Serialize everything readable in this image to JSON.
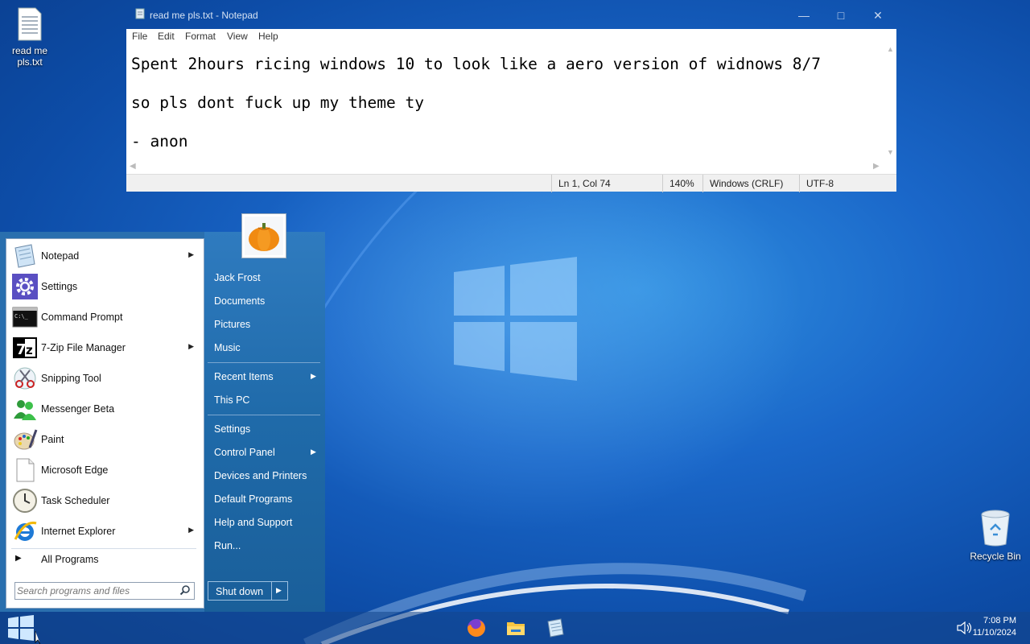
{
  "desktop": {
    "icons": [
      {
        "label": "read me pls.txt"
      },
      {
        "label": "Recycle Bin"
      }
    ]
  },
  "notepad": {
    "title": "read me pls.txt - Notepad",
    "menu": [
      "File",
      "Edit",
      "Format",
      "View",
      "Help"
    ],
    "lines": [
      "Spent 2hours ricing windows 10 to look like a aero version of widnows 8/7",
      "so pls dont fuck up my theme ty",
      "- anon"
    ],
    "status": {
      "position": "Ln 1, Col 74",
      "zoom": "140%",
      "line_ending": "Windows (CRLF)",
      "encoding": "UTF-8"
    }
  },
  "start_menu": {
    "programs": [
      {
        "label": "Notepad",
        "has_submenu": true,
        "icon": "notepad-icon"
      },
      {
        "label": "Settings",
        "has_submenu": false,
        "icon": "settings-gear-icon"
      },
      {
        "label": "Command Prompt",
        "has_submenu": false,
        "icon": "command-prompt-icon"
      },
      {
        "label": "7-Zip File Manager",
        "has_submenu": true,
        "icon": "7zip-icon"
      },
      {
        "label": "Snipping Tool",
        "has_submenu": false,
        "icon": "scissors-icon"
      },
      {
        "label": "Messenger Beta",
        "has_submenu": false,
        "icon": "messenger-icon"
      },
      {
        "label": "Paint",
        "has_submenu": false,
        "icon": "paint-palette-icon"
      },
      {
        "label": "Microsoft Edge",
        "has_submenu": false,
        "icon": "blank-document-icon"
      },
      {
        "label": "Task Scheduler",
        "has_submenu": false,
        "icon": "clock-icon"
      },
      {
        "label": "Internet Explorer",
        "has_submenu": true,
        "icon": "internet-explorer-icon"
      }
    ],
    "all_programs": "All Programs",
    "search_placeholder": "Search programs and files",
    "user_name": "Jack Frost",
    "right_links": [
      {
        "label": "Documents",
        "has_submenu": false
      },
      {
        "label": "Pictures",
        "has_submenu": false
      },
      {
        "label": "Music",
        "has_submenu": false
      },
      {
        "label": "Recent Items",
        "has_submenu": true
      },
      {
        "label": "This PC",
        "has_submenu": false
      },
      {
        "label": "Settings",
        "has_submenu": false
      },
      {
        "label": "Control Panel",
        "has_submenu": true
      },
      {
        "label": "Devices and Printers",
        "has_submenu": false
      },
      {
        "label": "Default Programs",
        "has_submenu": false
      },
      {
        "label": "Help and Support",
        "has_submenu": false
      },
      {
        "label": "Run...",
        "has_submenu": false
      }
    ],
    "shutdown_label": "Shut down"
  },
  "taskbar": {
    "pinned": [
      "firefox-icon",
      "file-explorer-icon",
      "notepad-icon"
    ],
    "time": "7:08 PM",
    "date": "11/10/2024"
  },
  "colors": {
    "wallpaper_blue": "#1a67c9",
    "start_right_blue": "#1f6aa9",
    "taskbar": "#14468c"
  }
}
